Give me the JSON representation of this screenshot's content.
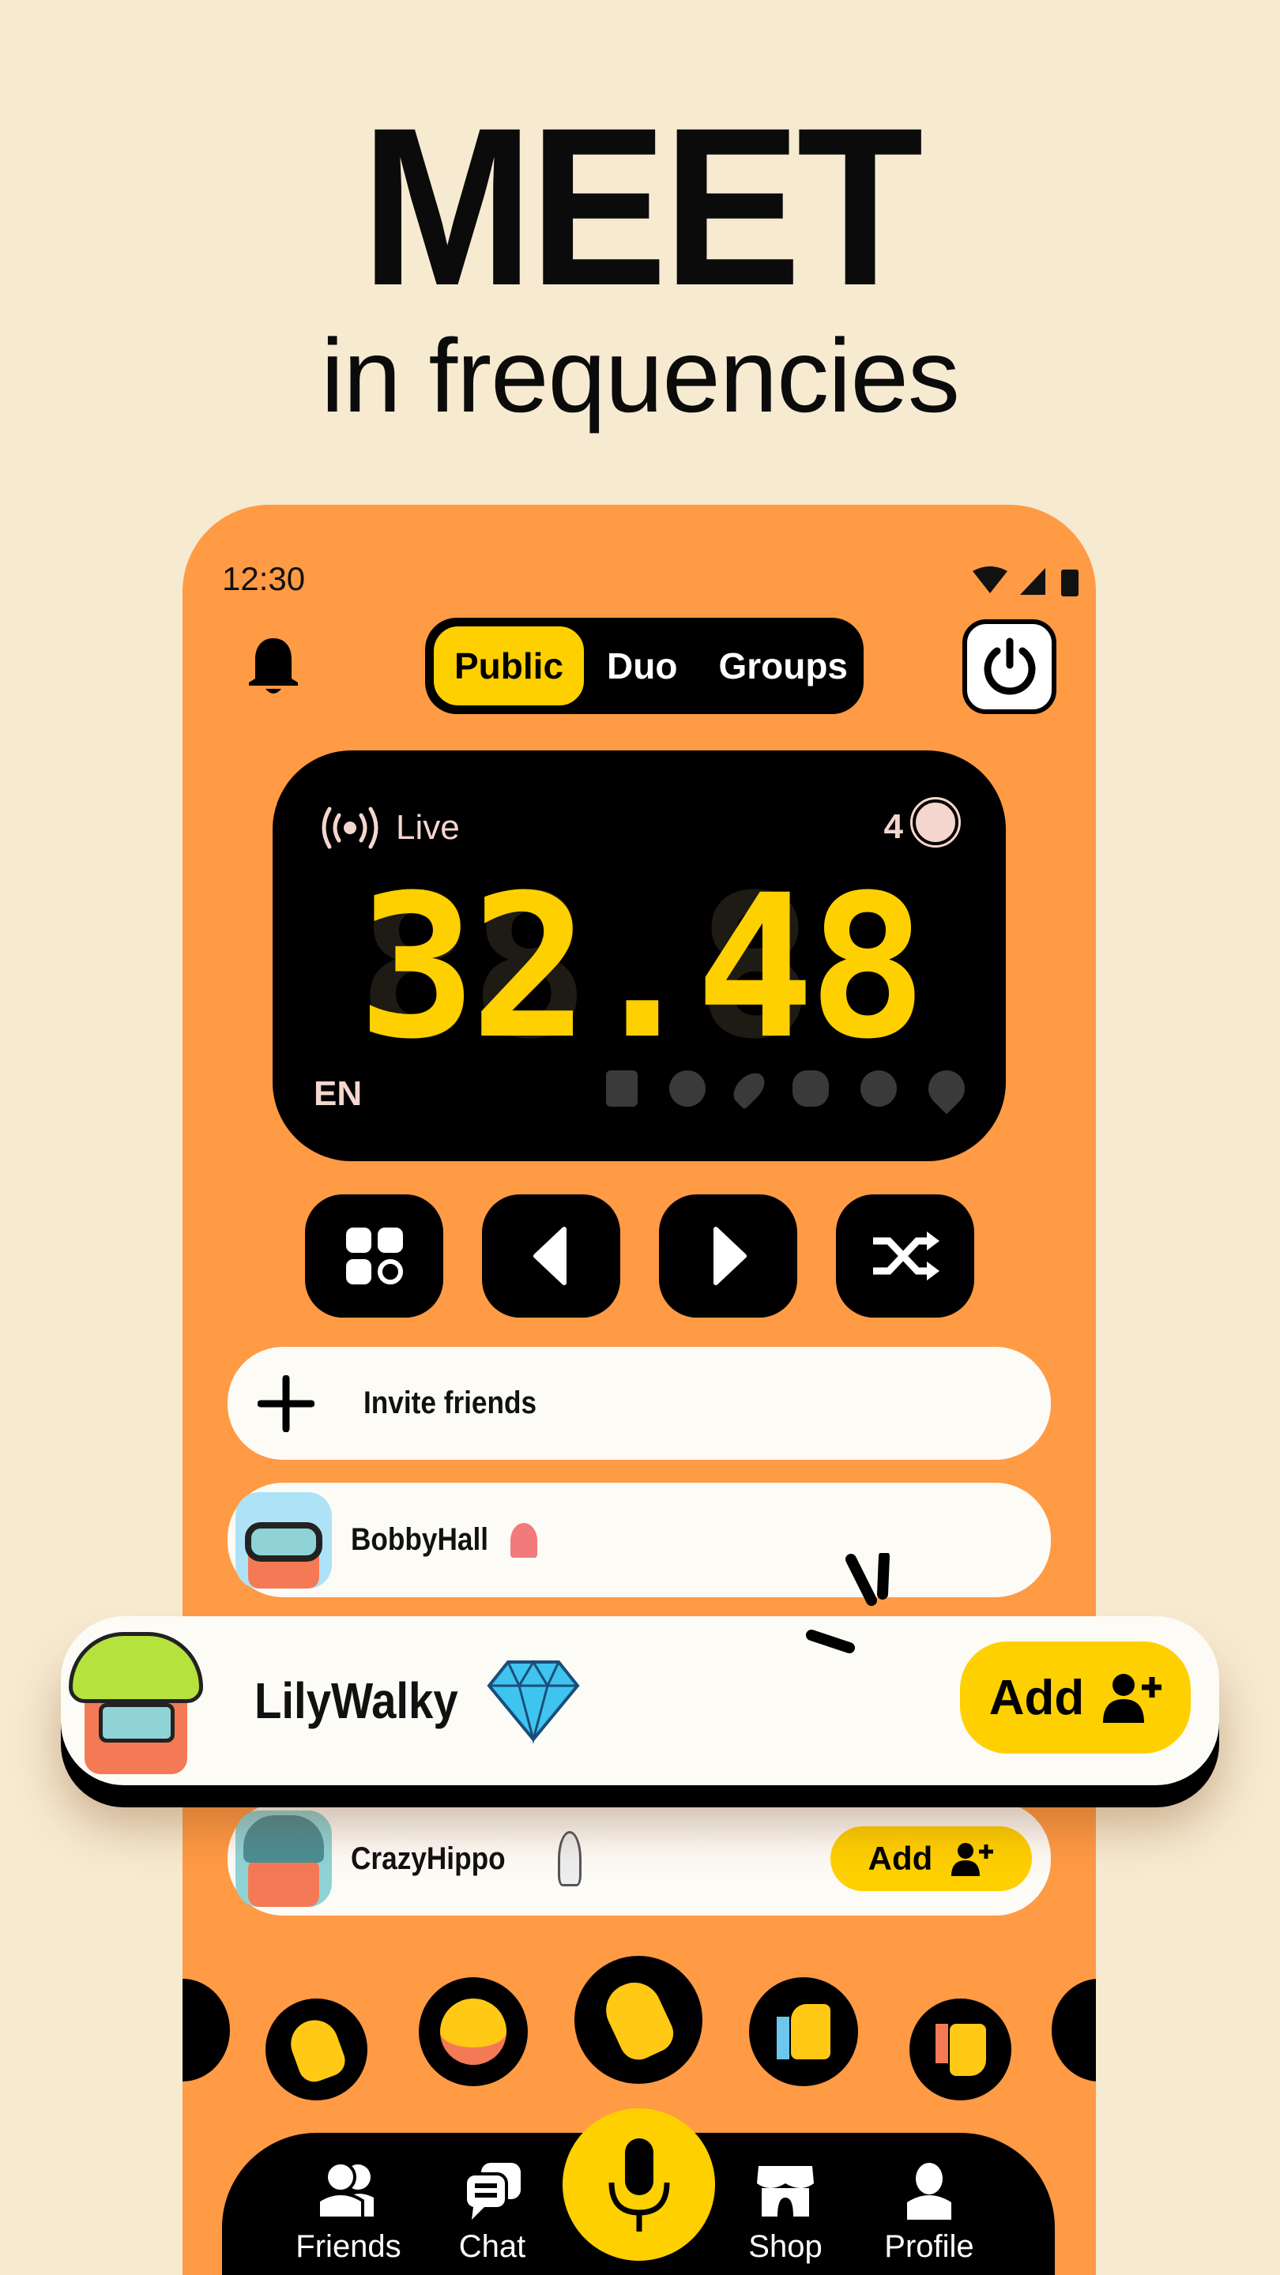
{
  "hero": {
    "title": "MEET",
    "subtitle": "in frequencies"
  },
  "status": {
    "time": "12:30"
  },
  "modes": {
    "items": [
      "Public",
      "Duo",
      "Groups"
    ],
    "selected": "Public"
  },
  "display": {
    "live_label": "Live",
    "listeners": "4",
    "frequency": "32.48",
    "ghost": "88.88",
    "language": "EN",
    "reactions": [
      "thumbs-down",
      "shocked",
      "rocket",
      "clap",
      "laugh",
      "heart"
    ]
  },
  "controls": [
    "apps-icon",
    "previous-icon",
    "next-icon",
    "shuffle-icon"
  ],
  "invite": {
    "label": "Invite friends"
  },
  "friends": [
    {
      "name": "BobbyHall",
      "badge": "parrot-sticker"
    },
    {
      "name": "LilyWalky",
      "badge": "diamond-sticker",
      "action": "Add"
    },
    {
      "name": "CrazyHippo",
      "badge": "goose-sticker",
      "action": "Add"
    }
  ],
  "reaction_bar": [
    "clapping-hands",
    "rolling-laughing",
    "waving-hand",
    "thumbs-up",
    "thumbs-down"
  ],
  "nav": {
    "items": [
      "Friends",
      "Chat",
      "Shop",
      "Profile"
    ]
  },
  "colors": {
    "background": "#f6ead0",
    "phone": "#ff9a45",
    "accent": "#ffd000",
    "dark": "#000000"
  }
}
